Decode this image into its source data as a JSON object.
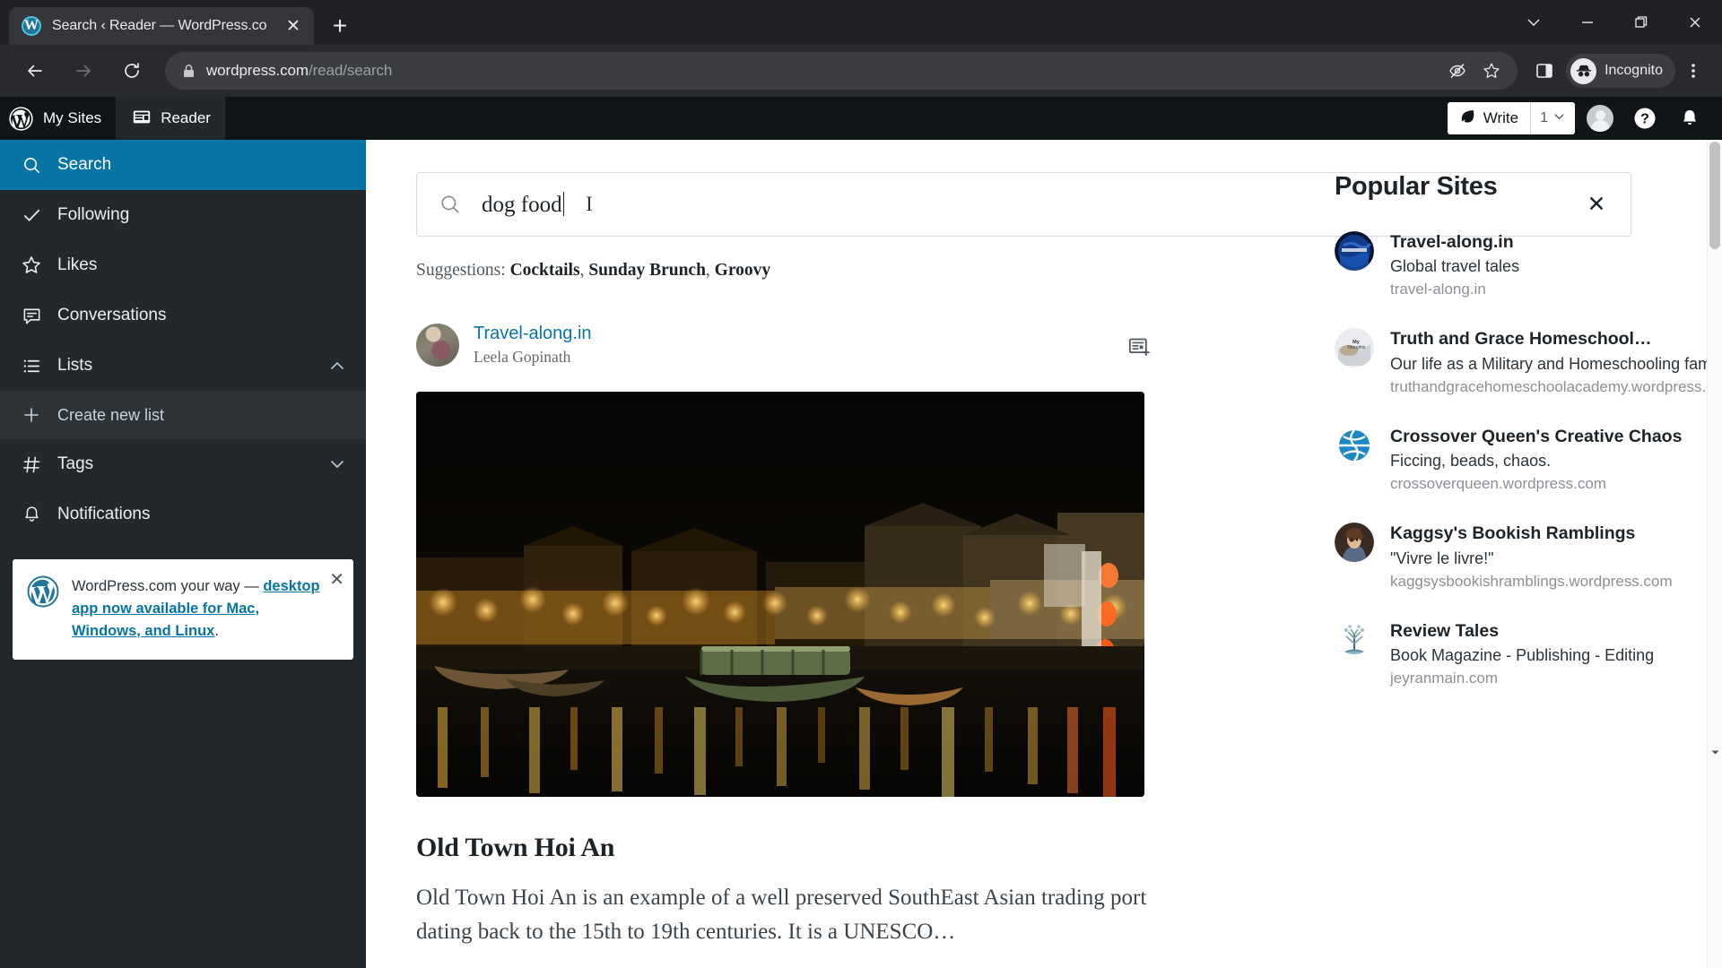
{
  "browser": {
    "tab": {
      "title": "Search ‹ Reader — WordPress.co",
      "favicon_name": "wordpress-favicon",
      "close_label": "✕"
    },
    "newtab_label": "+",
    "window_controls": {
      "more": "chevron-down",
      "minimize": "—",
      "maximize": "maximize",
      "close": "✕"
    },
    "nav": {
      "back": "back-arrow",
      "forward": "forward-arrow",
      "reload": "reload-arrow"
    },
    "url": {
      "domain": "wordpress.com",
      "path": "/read/search",
      "lock_icon": "lock-icon"
    },
    "omnibox_icons": [
      "third-party-cookie-blocked-icon",
      "bookmark-star-icon"
    ],
    "side_panel_icon": "side-panel-icon",
    "profile": {
      "label": "Incognito",
      "icon": "incognito-hat-icon"
    },
    "menu_icon": "three-dot-menu-icon"
  },
  "wp_header": {
    "logo": "W",
    "items": [
      {
        "label": "My Sites",
        "icon": "wordpress-logo-icon",
        "active": false
      },
      {
        "label": "Reader",
        "icon": "reader-icon",
        "active": true
      }
    ],
    "write": {
      "label": "Write",
      "icon": "leaf-icon",
      "count": "1",
      "chevron": "chevron-down-icon"
    },
    "icons": [
      "avatar",
      "help-icon",
      "bell-icon"
    ]
  },
  "sidebar": {
    "items": [
      {
        "label": "Search",
        "icon": "search-icon",
        "selected": true
      },
      {
        "label": "Following",
        "icon": "check-icon",
        "selected": false
      },
      {
        "label": "Likes",
        "icon": "star-icon",
        "selected": false
      },
      {
        "label": "Conversations",
        "icon": "comment-icon",
        "selected": false
      },
      {
        "label": "Lists",
        "icon": "list-icon",
        "selected": false,
        "chevron": "chevron-up-icon"
      }
    ],
    "create_new_list": {
      "label": "Create new list",
      "icon": "plus-icon"
    },
    "tags": {
      "label": "Tags",
      "icon": "hash-icon",
      "chevron": "chevron-down-icon"
    },
    "notifications": {
      "label": "Notifications",
      "icon": "bell-icon"
    },
    "promo": {
      "lead": "WordPress.com your way — ",
      "link": "desktop app now available for Mac, Windows, and Linux",
      "trailing": ".",
      "close": "✕",
      "logo": "wordpress-logo-icon"
    }
  },
  "search": {
    "value": "dog food",
    "icon": "search-icon",
    "clear": "✕",
    "suggestions_label": "Suggestions:",
    "suggestions": [
      "Cocktails",
      "Sunday Brunch",
      "Groovy"
    ]
  },
  "post": {
    "site": "Travel-along.in",
    "author": "Leela Gopinath",
    "action_icon": "add-to-list-icon",
    "title": "Old Town Hoi An",
    "excerpt": "Old Town Hoi An is an example of a well preserved SouthEast Asian trading port dating back to the 15th to 19th centuries. It is a UNESCO…",
    "image_alt": "night-riverfront-lanterns-hoi-an"
  },
  "popular": {
    "title": "Popular Sites",
    "sites": [
      {
        "name": "Travel-along.in",
        "desc": "Global travel tales",
        "url": "travel-along.in",
        "avatar": "globe-blue-avatar"
      },
      {
        "name": "Truth and Grace Homeschool…",
        "desc": "Our life as a Military and Homeschooling family…",
        "url": "truthandgracehomeschoolacademy.wordpress.com",
        "avatar": "my-thoughts-avatar"
      },
      {
        "name": "Crossover Queen's Creative Chaos",
        "desc": "Ficcing, beads, chaos.",
        "url": "crossoverqueen.wordpress.com",
        "avatar": "globe-icon-avatar"
      },
      {
        "name": "Kaggsy's Bookish Ramblings",
        "desc": "\"Vivre le livre!\"",
        "url": "kaggsysbookishramblings.wordpress.com",
        "avatar": "portrait-painting-avatar"
      },
      {
        "name": "Review Tales",
        "desc": "Book Magazine - Publishing - Editing",
        "url": "jeyranmain.com",
        "avatar": "tree-book-avatar"
      }
    ]
  },
  "colors": {
    "wp_blue": "#0675a5",
    "sidebar_bg": "#23282d",
    "header_bg": "#101517"
  }
}
